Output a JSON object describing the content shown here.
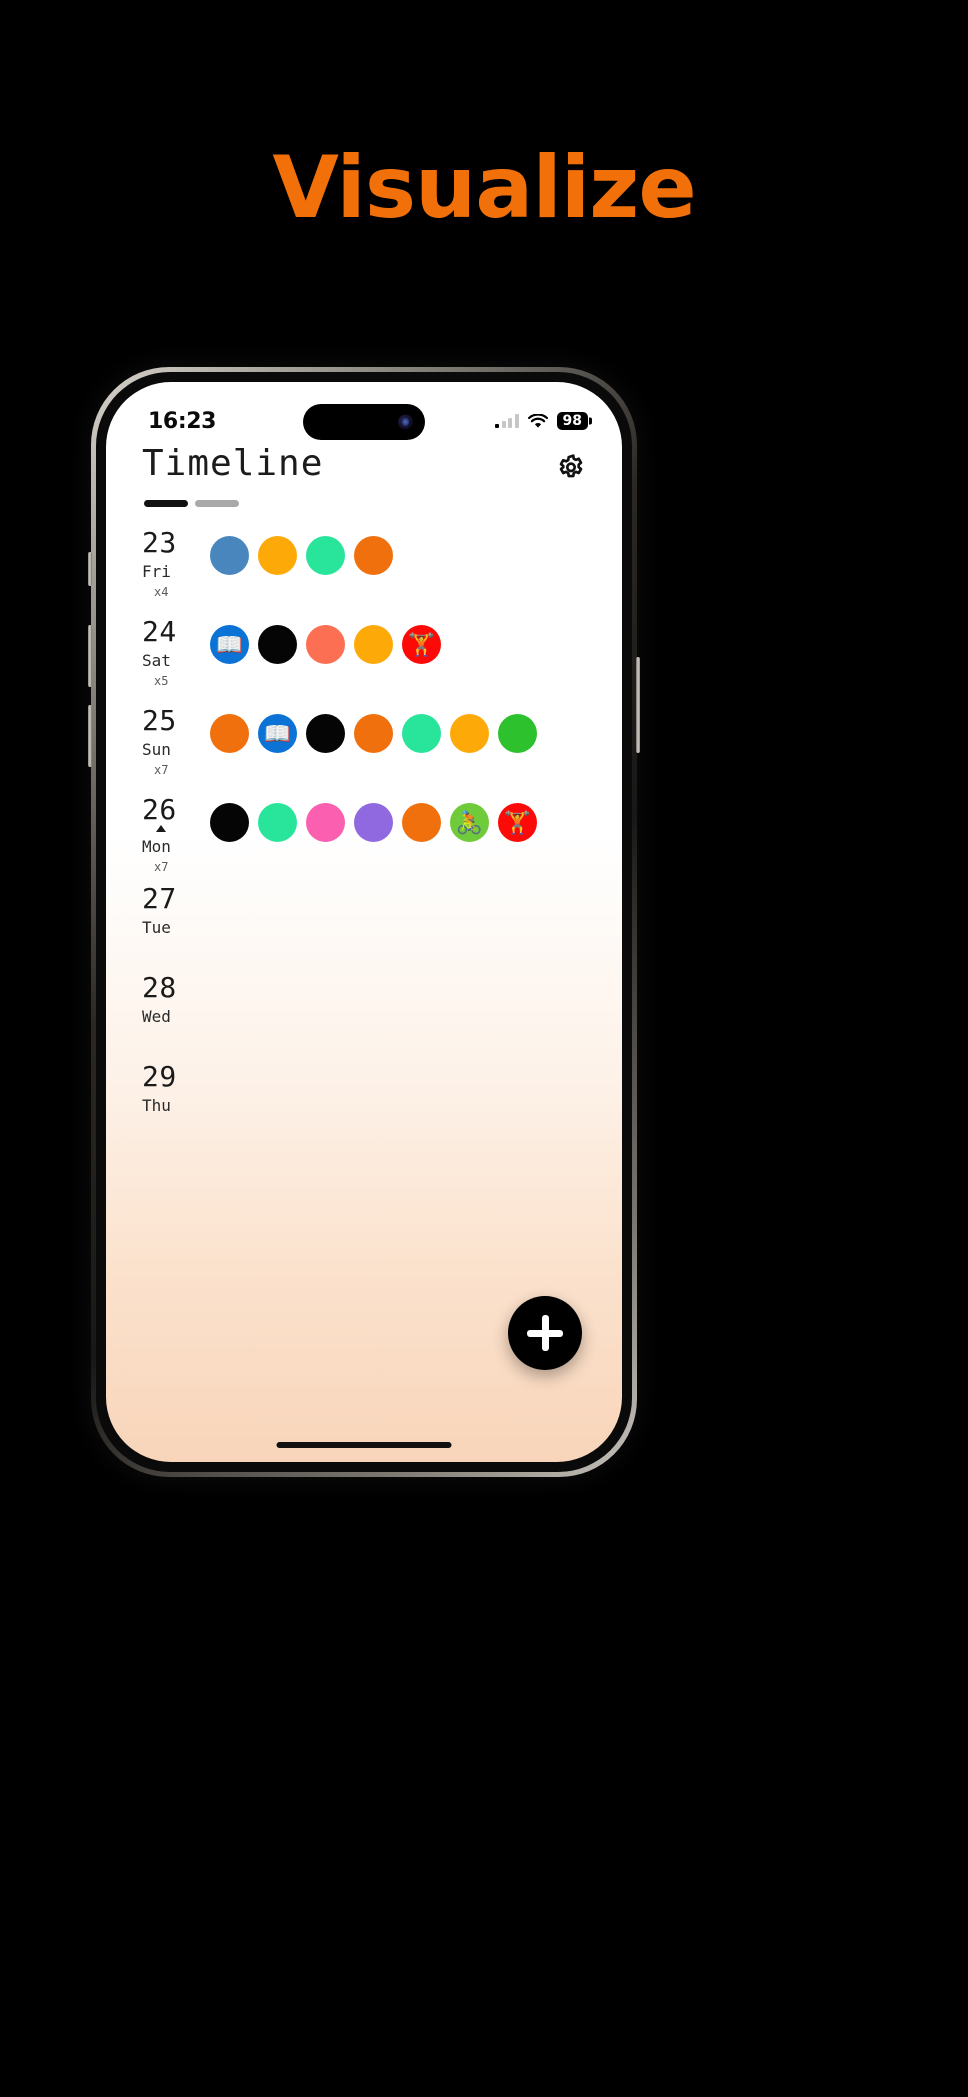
{
  "headline": "Visualize",
  "colors": {
    "headline": "#F2700A",
    "blue": "#4A86BE",
    "amber": "#FDAA08",
    "spring_green": "#29E59B",
    "orange": "#F1700E",
    "black": "#050505",
    "coral": "#FD6F53",
    "red": "#FB0A07",
    "book_blue": "#0B72D6",
    "pink": "#FB5FAF",
    "purple": "#9069E0",
    "green": "#2DC22D"
  },
  "statusbar": {
    "time": "16:23",
    "signal_icon": "cellular-signal-icon",
    "wifi_icon": "wifi-icon",
    "battery_level": "98"
  },
  "header": {
    "title": "Timeline",
    "settings_icon": "gear-icon"
  },
  "pager": {
    "pages": 2,
    "active": 0
  },
  "fab": {
    "icon": "plus-icon",
    "label": "+"
  },
  "timeline": {
    "days": [
      {
        "num": "23",
        "name": "Fri",
        "count": "x4",
        "today": false,
        "entries": [
          {
            "color": "#4A86BE",
            "emoji": ""
          },
          {
            "color": "#FDAA08",
            "emoji": ""
          },
          {
            "color": "#29E59B",
            "emoji": ""
          },
          {
            "color": "#F1700E",
            "emoji": ""
          }
        ]
      },
      {
        "num": "24",
        "name": "Sat",
        "count": "x5",
        "today": false,
        "entries": [
          {
            "color": "#0B72D6",
            "emoji": "📖"
          },
          {
            "color": "#050505",
            "emoji": ""
          },
          {
            "color": "#FD6F53",
            "emoji": ""
          },
          {
            "color": "#FDAA08",
            "emoji": ""
          },
          {
            "color": "#FB0A07",
            "emoji": "🏋"
          }
        ]
      },
      {
        "num": "25",
        "name": "Sun",
        "count": "x7",
        "today": false,
        "entries": [
          {
            "color": "#F1700E",
            "emoji": ""
          },
          {
            "color": "#0B72D6",
            "emoji": "📖"
          },
          {
            "color": "#050505",
            "emoji": ""
          },
          {
            "color": "#F1700E",
            "emoji": ""
          },
          {
            "color": "#29E59B",
            "emoji": ""
          },
          {
            "color": "#FDAA08",
            "emoji": ""
          },
          {
            "color": "#2DC22D",
            "emoji": ""
          }
        ]
      },
      {
        "num": "26",
        "name": "Mon",
        "count": "x7",
        "today": true,
        "entries": [
          {
            "color": "#050505",
            "emoji": ""
          },
          {
            "color": "#29E59B",
            "emoji": ""
          },
          {
            "color": "#FB5FAF",
            "emoji": ""
          },
          {
            "color": "#9069E0",
            "emoji": ""
          },
          {
            "color": "#F1700E",
            "emoji": ""
          },
          {
            "color": "#6FCB3A",
            "emoji": "🚴"
          },
          {
            "color": "#FB0A07",
            "emoji": "🏋"
          }
        ]
      },
      {
        "num": "27",
        "name": "Tue",
        "count": "",
        "today": false,
        "entries": []
      },
      {
        "num": "28",
        "name": "Wed",
        "count": "",
        "today": false,
        "entries": []
      },
      {
        "num": "29",
        "name": "Thu",
        "count": "",
        "today": false,
        "entries": []
      }
    ]
  }
}
